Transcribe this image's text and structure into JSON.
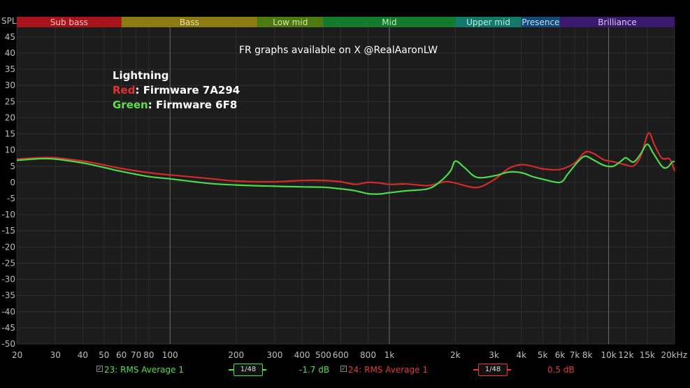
{
  "spl_label": "SPL",
  "chart_data": {
    "type": "line",
    "title": "FR graphs available on X @RealAaronLW",
    "x_scale": "log",
    "xlim": [
      20,
      20000
    ],
    "ylim": [
      -50,
      48
    ],
    "x_ticks": [
      {
        "v": 20,
        "label": "20",
        "major": false
      },
      {
        "v": 30,
        "label": "30",
        "major": false
      },
      {
        "v": 40,
        "label": "40",
        "major": false
      },
      {
        "v": 50,
        "label": "50",
        "major": false
      },
      {
        "v": 60,
        "label": "60",
        "major": false
      },
      {
        "v": 70,
        "label": "70",
        "major": false
      },
      {
        "v": 80,
        "label": "80",
        "major": false
      },
      {
        "v": 100,
        "label": "100",
        "major": true
      },
      {
        "v": 200,
        "label": "200",
        "major": false
      },
      {
        "v": 300,
        "label": "300",
        "major": false
      },
      {
        "v": 400,
        "label": "400",
        "major": false
      },
      {
        "v": 500,
        "label": "500",
        "major": false
      },
      {
        "v": 600,
        "label": "600",
        "major": false
      },
      {
        "v": 800,
        "label": "800",
        "major": false
      },
      {
        "v": 1000,
        "label": "1k",
        "major": true
      },
      {
        "v": 2000,
        "label": "2k",
        "major": false
      },
      {
        "v": 3000,
        "label": "3k",
        "major": false
      },
      {
        "v": 4000,
        "label": "4k",
        "major": false
      },
      {
        "v": 5000,
        "label": "5k",
        "major": false
      },
      {
        "v": 6000,
        "label": "6k",
        "major": false
      },
      {
        "v": 7000,
        "label": "7k",
        "major": false
      },
      {
        "v": 8000,
        "label": "8k",
        "major": false
      },
      {
        "v": 10000,
        "label": "10k",
        "major": true
      },
      {
        "v": 12000,
        "label": "12k",
        "major": false
      },
      {
        "v": 15000,
        "label": "15k",
        "major": false
      },
      {
        "v": 20000,
        "label": "20kHz",
        "major": false
      }
    ],
    "y_ticks": [
      45,
      40,
      35,
      30,
      25,
      20,
      15,
      10,
      5,
      0,
      -5,
      -10,
      -15,
      -20,
      -25,
      -30,
      -35,
      -40,
      -45,
      -50
    ],
    "bands": [
      {
        "label": "Sub bass",
        "from": 20,
        "to": 60,
        "color": "#a8141c",
        "text": "#f0c0c0"
      },
      {
        "label": "Bass",
        "from": 60,
        "to": 250,
        "color": "#8c7a12",
        "text": "#e9dca0"
      },
      {
        "label": "Low mid",
        "from": 250,
        "to": 500,
        "color": "#4e7a12",
        "text": "#cfe3a8"
      },
      {
        "label": "Mid",
        "from": 500,
        "to": 2000,
        "color": "#147a2c",
        "text": "#bfe8c8"
      },
      {
        "label": "Upper mid",
        "from": 2000,
        "to": 4000,
        "color": "#127a6c",
        "text": "#bfe8e0"
      },
      {
        "label": "Presence",
        "from": 4000,
        "to": 6000,
        "color": "#124a7a",
        "text": "#c8d8f0"
      },
      {
        "label": "Brilliance",
        "from": 6000,
        "to": 20000,
        "color": "#3a1a6e",
        "text": "#d8c8f0"
      }
    ],
    "legend": {
      "heading": "Lightning",
      "entries": [
        {
          "key": "Red",
          "text": ": Firmware 7A294",
          "color": "#e53030"
        },
        {
          "key": "Green",
          "text": ": Firmware 6F8",
          "color": "#5ee04a"
        }
      ]
    },
    "series": [
      {
        "color": "#d42a2a",
        "points": [
          [
            20,
            7.2
          ],
          [
            25,
            7.6
          ],
          [
            30,
            7.6
          ],
          [
            40,
            6.6
          ],
          [
            50,
            5.4
          ],
          [
            60,
            4.3
          ],
          [
            80,
            3.0
          ],
          [
            100,
            2.3
          ],
          [
            150,
            1.2
          ],
          [
            200,
            0.4
          ],
          [
            300,
            0.2
          ],
          [
            400,
            0.6
          ],
          [
            500,
            0.6
          ],
          [
            600,
            0.2
          ],
          [
            700,
            -0.6
          ],
          [
            800,
            0
          ],
          [
            900,
            -0.2
          ],
          [
            1000,
            -0.6
          ],
          [
            1200,
            -0.5
          ],
          [
            1500,
            -1.0
          ],
          [
            1800,
            0.2
          ],
          [
            2000,
            -0.2
          ],
          [
            2500,
            -1.6
          ],
          [
            3000,
            0.8
          ],
          [
            3500,
            4.3
          ],
          [
            4000,
            5.5
          ],
          [
            4500,
            5.0
          ],
          [
            5000,
            4.2
          ],
          [
            6000,
            4.0
          ],
          [
            7000,
            6.0
          ],
          [
            7800,
            9.3
          ],
          [
            8500,
            9.0
          ],
          [
            9500,
            7.0
          ],
          [
            10500,
            6.4
          ],
          [
            12000,
            5.4
          ],
          [
            13000,
            5.1
          ],
          [
            14000,
            8.0
          ],
          [
            15200,
            15.2
          ],
          [
            16200,
            11.5
          ],
          [
            17500,
            7.5
          ],
          [
            19000,
            7.2
          ],
          [
            20000,
            3.5
          ]
        ]
      },
      {
        "color": "#4cd94c",
        "points": [
          [
            20,
            6.8
          ],
          [
            25,
            7.3
          ],
          [
            30,
            7.2
          ],
          [
            40,
            6.0
          ],
          [
            50,
            4.6
          ],
          [
            60,
            3.4
          ],
          [
            80,
            1.8
          ],
          [
            100,
            1.1
          ],
          [
            150,
            -0.3
          ],
          [
            200,
            -0.8
          ],
          [
            300,
            -1.2
          ],
          [
            400,
            -1.4
          ],
          [
            500,
            -1.5
          ],
          [
            600,
            -2.0
          ],
          [
            700,
            -2.6
          ],
          [
            800,
            -3.5
          ],
          [
            900,
            -3.6
          ],
          [
            1000,
            -3.2
          ],
          [
            1200,
            -2.6
          ],
          [
            1500,
            -2.0
          ],
          [
            1700,
            0.2
          ],
          [
            1900,
            3.5
          ],
          [
            2000,
            6.6
          ],
          [
            2200,
            4.6
          ],
          [
            2500,
            1.6
          ],
          [
            3000,
            2.0
          ],
          [
            3500,
            3.2
          ],
          [
            4000,
            3.0
          ],
          [
            4500,
            1.8
          ],
          [
            5000,
            1.0
          ],
          [
            6000,
            0
          ],
          [
            6500,
            2.5
          ],
          [
            7200,
            6.2
          ],
          [
            7800,
            8.1
          ],
          [
            8500,
            7.0
          ],
          [
            9500,
            5.3
          ],
          [
            10500,
            5.0
          ],
          [
            11500,
            6.8
          ],
          [
            12000,
            7.6
          ],
          [
            13000,
            6.3
          ],
          [
            14000,
            8.8
          ],
          [
            15000,
            11.8
          ],
          [
            16000,
            9.0
          ],
          [
            17500,
            5.0
          ],
          [
            18500,
            4.6
          ],
          [
            19500,
            6.3
          ],
          [
            20000,
            6.5
          ]
        ]
      }
    ]
  },
  "footer": {
    "green_check": "✓",
    "green_label": "23: RMS Average 1",
    "green_smooth": "1/48",
    "green_db": "-1.7 dB",
    "red_check": "✓",
    "red_label": "24: RMS Average 1",
    "red_smooth": "1/48",
    "red_db": "0.5 dB"
  }
}
